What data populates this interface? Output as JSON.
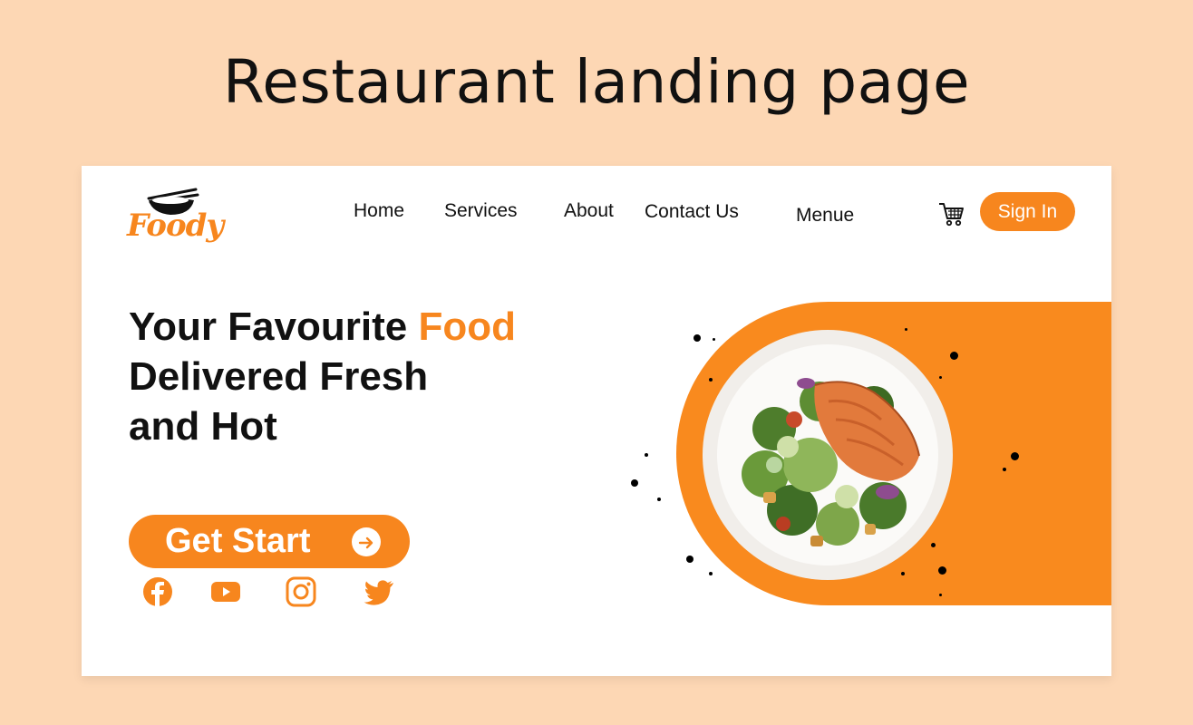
{
  "heading": "Restaurant landing page",
  "brand": {
    "name": "Foody"
  },
  "nav": {
    "items": [
      "Home",
      "Services",
      "About",
      "Contact Us",
      "Menue"
    ],
    "sign_in": "Sign In"
  },
  "hero": {
    "title_prefix": "Your Favourite ",
    "title_accent": "Food",
    "title_line2": "Delivered Fresh",
    "title_line3": "and Hot",
    "cta_label": "Get Start"
  },
  "social": [
    "facebook-icon",
    "youtube-icon",
    "instagram-icon",
    "twitter-icon"
  ],
  "colors": {
    "accent": "#f7861e",
    "background": "#fdd7b4",
    "card": "#ffffff",
    "text": "#111111"
  }
}
